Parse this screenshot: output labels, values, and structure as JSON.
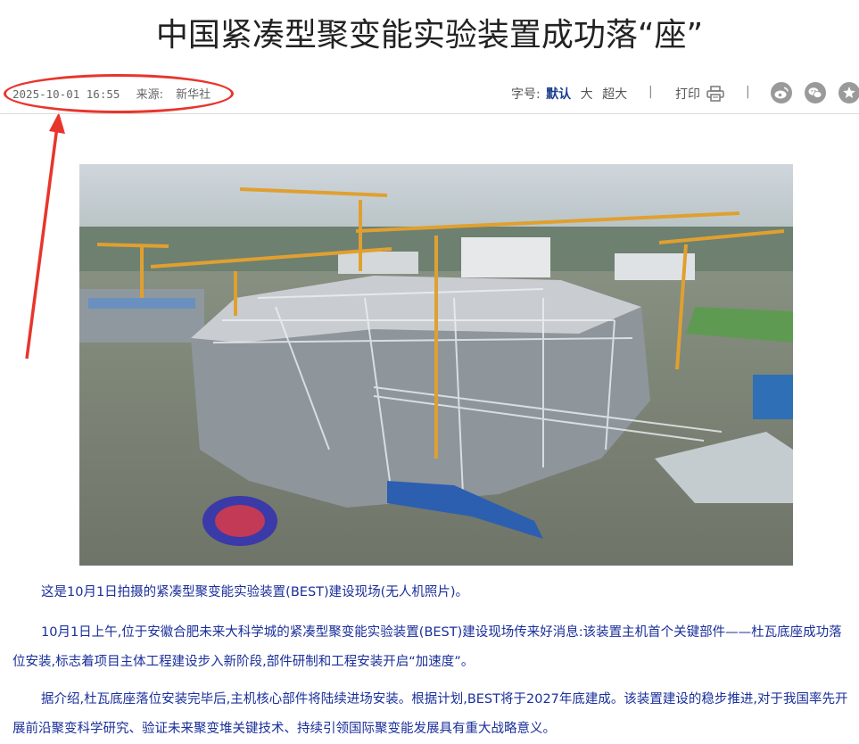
{
  "article": {
    "title": "中国紧凑型聚变能实验装置成功落“座”",
    "date": "2025-10-01 16:55",
    "source_label": "来源:",
    "source": "新华社"
  },
  "toolbar": {
    "font_size_label": "字号:",
    "size_default": "默认",
    "size_large": "大",
    "size_xl": "超大",
    "separator": "|",
    "print_label": "打印"
  },
  "share": {
    "icons": [
      "weibo-icon",
      "wechat-icon",
      "favorite-icon"
    ]
  },
  "photo": {
    "description_caption": "这是10月1日拍摄的紧凑型聚变能实验装置(BEST)建设现场(无人机照片)。"
  },
  "body": {
    "para1": "10月1日上午,位于安徽合肥未来大科学城的紧凑型聚变能实验装置(BEST)建设现场传来好消息:该装置主机首个关键部件——杜瓦底座成功落位安装,标志着项目主体工程建设步入新阶段,部件研制和工程安装开启“加速度”。",
    "para2": "据介绍,杜瓦底座落位安装完毕后,主机核心部件将陆续进场安装。根据计划,BEST将于2027年底建成。该装置建设的稳步推进,对于我国率先开展前沿聚变科学研究、验证未来聚变堆关键技术、持续引领国际聚变能发展具有重大战略意义。"
  },
  "colors": {
    "link_blue": "#1a2f9a",
    "annotation_red": "#e8352c",
    "icon_gray": "#9a9a9a"
  }
}
